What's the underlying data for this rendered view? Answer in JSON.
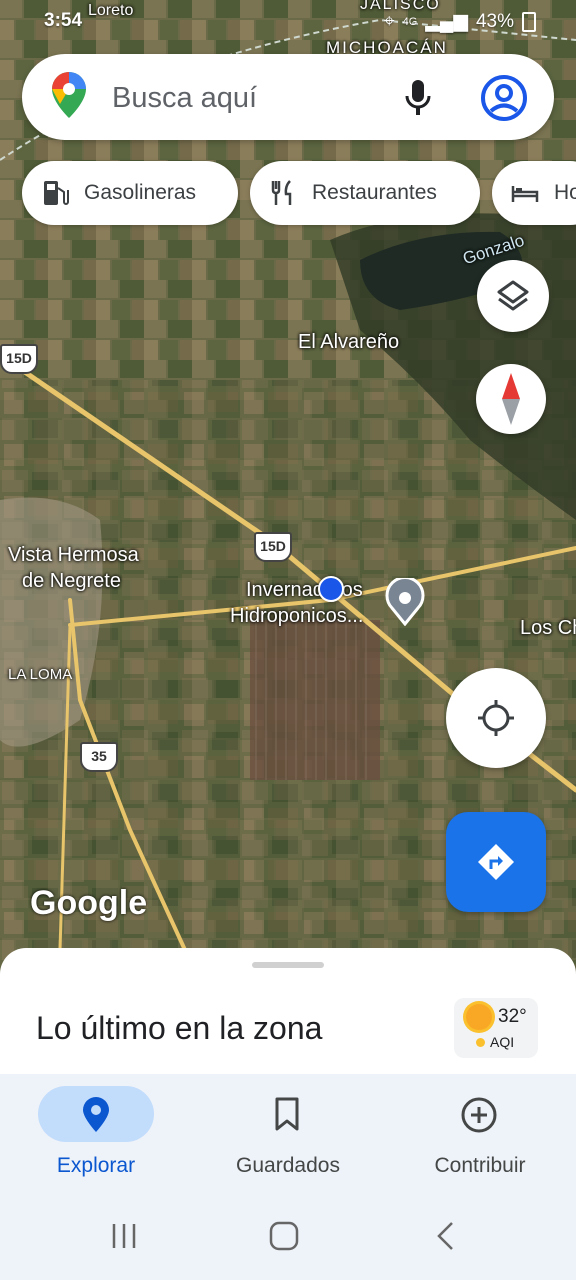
{
  "status_bar": {
    "time": "3:54",
    "battery": "43%",
    "network": "4G"
  },
  "search": {
    "placeholder": "Busca aquí"
  },
  "chips": [
    {
      "label": "Gasolineras",
      "icon": "gas-station-icon"
    },
    {
      "label": "Restaurantes",
      "icon": "restaurant-icon"
    },
    {
      "label": "Ho",
      "icon": "hotel-icon"
    }
  ],
  "map": {
    "labels": {
      "alvareno": "El Alvareño",
      "vista1": "Vista Hermosa",
      "vista2": "de Negrete",
      "invern1": "Invernaderos",
      "invern2": "Hidroponicos...",
      "laloma": "LA LOMA",
      "losch": "Los Ch",
      "gonzalo": "Gonzalo",
      "loreto": "Loreto",
      "jalisco": "JALISCO",
      "michoacan": "MICHOACÁN"
    },
    "shields": {
      "s1": "15D",
      "s2": "15D",
      "s3": "35"
    },
    "watermark": "Google"
  },
  "sheet": {
    "title": "Lo último en la zona",
    "weather": {
      "temp": "32°",
      "aqi": "AQI"
    }
  },
  "bottom_nav": [
    {
      "label": "Explorar",
      "icon": "explore-pin-icon",
      "active": true
    },
    {
      "label": "Guardados",
      "icon": "bookmark-icon",
      "active": false
    },
    {
      "label": "Contribuir",
      "icon": "add-circle-icon",
      "active": false
    }
  ],
  "colors": {
    "accent": "#0b57d0",
    "directions_button": "#1a73e8",
    "user_location": "#1a57e8"
  }
}
